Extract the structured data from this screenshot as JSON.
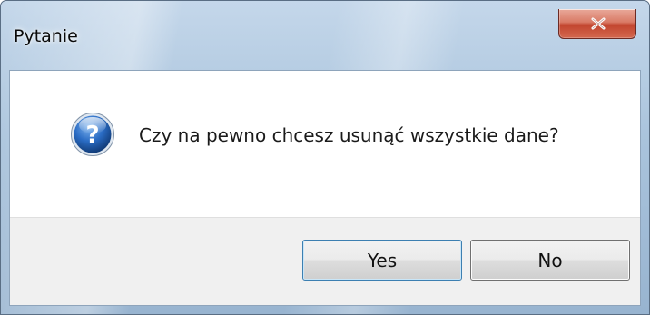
{
  "window": {
    "title": "Pytanie"
  },
  "dialog": {
    "icon": "question-icon",
    "message": "Czy na pewno chcesz usunąć wszystkie dane?"
  },
  "buttons": {
    "yes_label": "Yes",
    "no_label": "No"
  },
  "colors": {
    "title_bar": "#a9c3dc",
    "close_button": "#c2452f",
    "dialog_body": "#ffffff",
    "button_area": "#f0f0f0",
    "icon": "#1f5fb0"
  }
}
